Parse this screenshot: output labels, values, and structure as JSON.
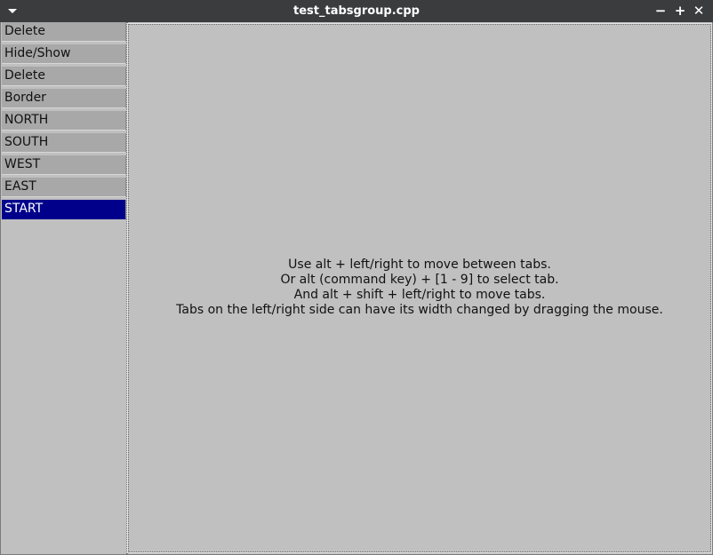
{
  "window": {
    "title": "test_tabsgroup.cpp",
    "controls": {
      "menu_icon": "chevron-down-icon",
      "minimize": "−",
      "maximize": "+",
      "close": "✕"
    }
  },
  "tabs": [
    {
      "label": "Delete",
      "selected": false
    },
    {
      "label": "Hide/Show",
      "selected": false
    },
    {
      "label": "Delete",
      "selected": false
    },
    {
      "label": "Border",
      "selected": false
    },
    {
      "label": "NORTH",
      "selected": false
    },
    {
      "label": "SOUTH",
      "selected": false
    },
    {
      "label": "WEST",
      "selected": false
    },
    {
      "label": "EAST",
      "selected": false
    },
    {
      "label": "START",
      "selected": true
    }
  ],
  "content": {
    "lines": [
      "Use alt + left/right to move between tabs.",
      "Or alt (command key) + [1 - 9] to select tab.",
      "And alt + shift + left/right to move tabs.",
      "Tabs on the left/right side can have its width changed by dragging the mouse."
    ]
  },
  "colors": {
    "titlebar": "#3a3c3e",
    "background": "#c0c0c0",
    "tab": "#a8a8a8",
    "selected_tab": "#00008b"
  }
}
